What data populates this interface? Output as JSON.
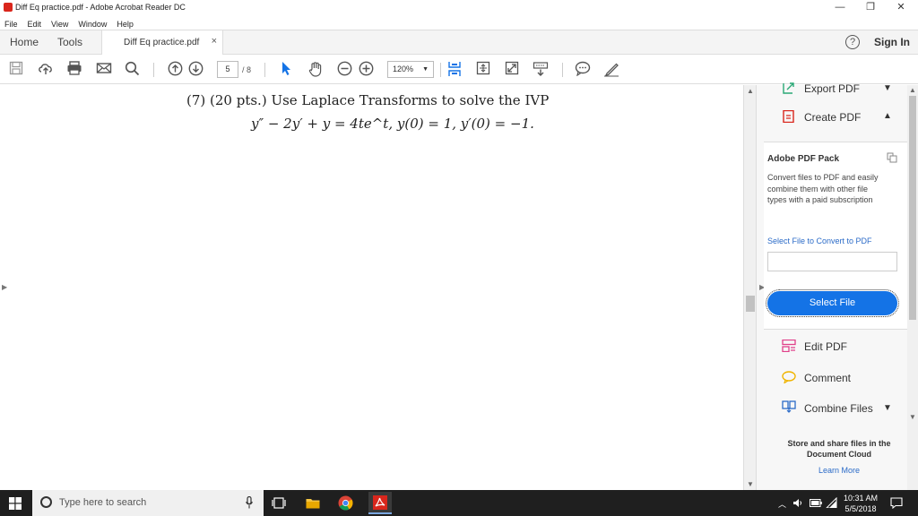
{
  "window": {
    "title": "Diff Eq practice.pdf - Adobe Acrobat Reader DC",
    "minimize": "—",
    "restore": "❐",
    "close": "✕"
  },
  "menu": [
    "File",
    "Edit",
    "View",
    "Window",
    "Help"
  ],
  "tabs": {
    "home": "Home",
    "tools": "Tools",
    "document": "Diff Eq practice.pdf",
    "close": "×",
    "help": "?",
    "sign_in": "Sign In"
  },
  "toolbar": {
    "page_current": "5",
    "page_total": "/ 8",
    "zoom": "120%",
    "zoom_caret": "▼"
  },
  "document": {
    "problem_text": "(7) (20 pts.) Use Laplace Transforms to solve the IVP",
    "equation": "y″ − 2y′ + y = 4te^t,   y(0) = 1, y′(0) = −1."
  },
  "right_pane": {
    "export_pdf": "Export PDF",
    "create_pdf": "Create PDF",
    "pack_title": "Adobe PDF Pack",
    "pack_desc": "Convert files to PDF and easily combine them with other file types with a paid subscription",
    "pack_link": "Select File to Convert to PDF",
    "select_file": "Select File",
    "edit_pdf": "Edit PDF",
    "comment": "Comment",
    "combine_files": "Combine Files",
    "store_text": "Store and share files in the Document Cloud",
    "learn_more": "Learn More"
  },
  "taskbar": {
    "search_placeholder": "Type here to search",
    "time": "10:31 AM",
    "date": "5/5/2018"
  },
  "colors": {
    "accent_blue": "#1473e6",
    "link_blue": "#2b6bc8",
    "acrobat_red": "#d9261c"
  }
}
